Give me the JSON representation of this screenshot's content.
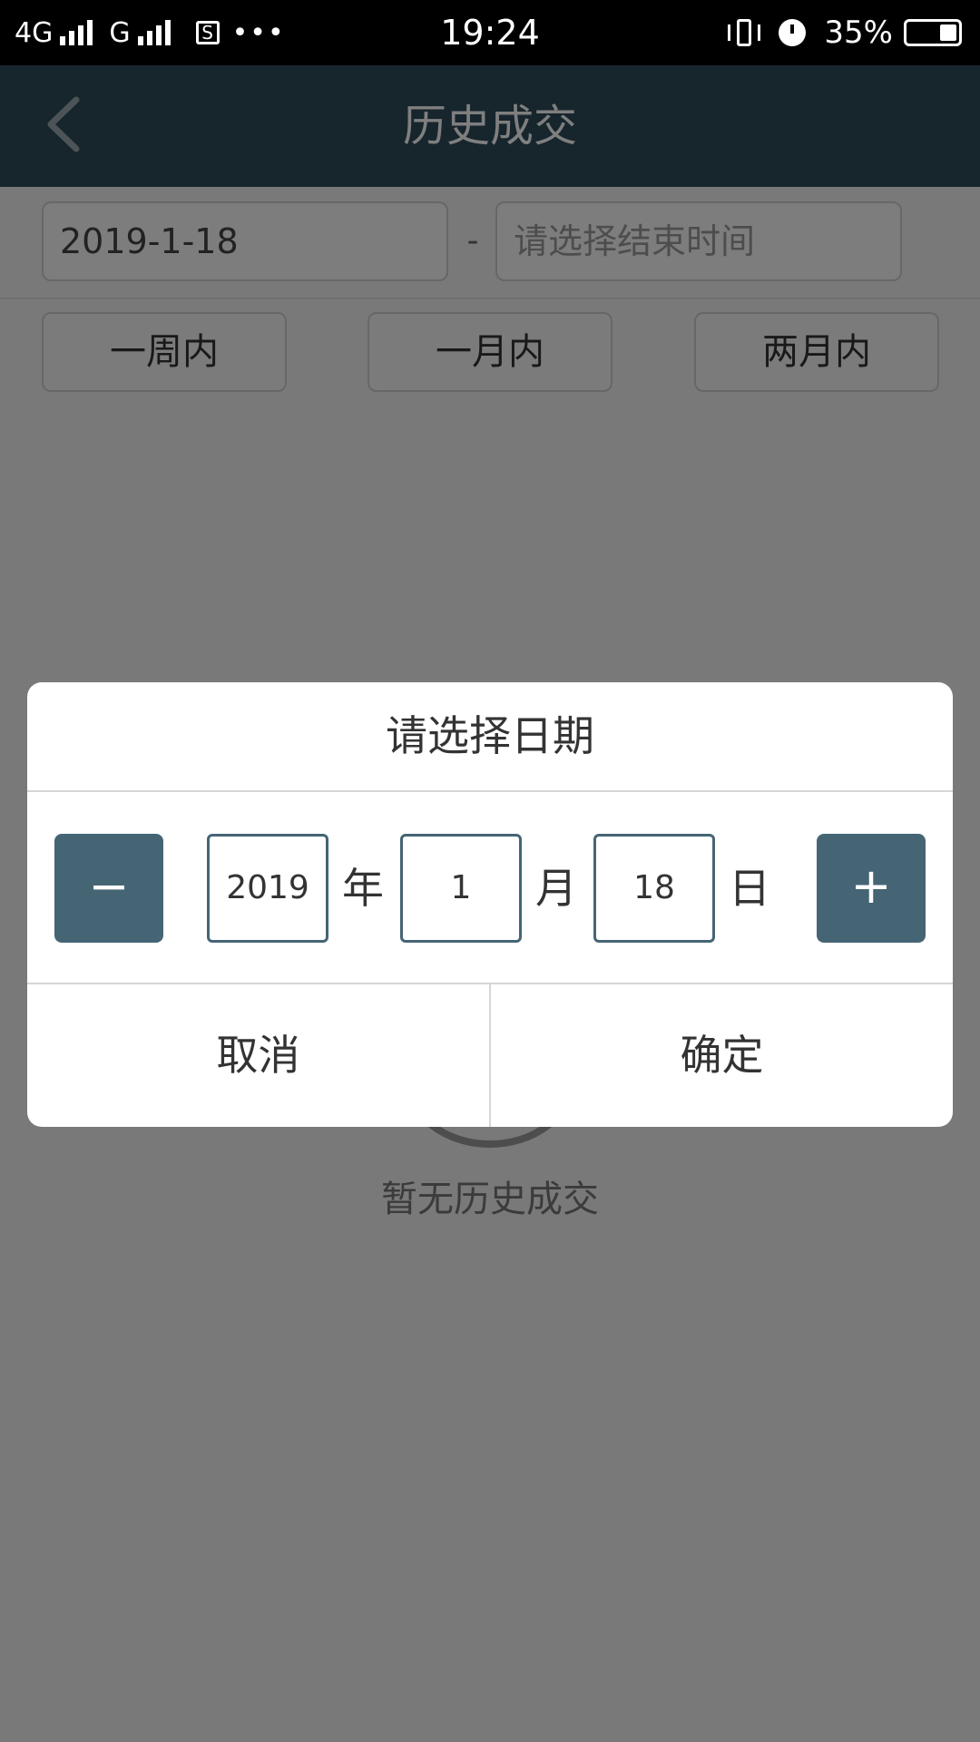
{
  "status_bar": {
    "network1": "4G",
    "network2": "G",
    "dots": "•••",
    "time": "19:24",
    "battery": "35%"
  },
  "header": {
    "title": "历史成交"
  },
  "filter": {
    "start_date": "2019-1-18",
    "separator": "-",
    "end_placeholder": "请选择结束时间",
    "ranges": [
      "一周内",
      "一月内",
      "两月内"
    ]
  },
  "content": {
    "empty_text": "暂无历史成交"
  },
  "dialog": {
    "title": "请选择日期",
    "minus_label": "−",
    "plus_label": "+",
    "year": "2019",
    "month": "1",
    "day": "18",
    "year_unit": "年",
    "month_unit": "月",
    "day_unit": "日",
    "cancel": "取消",
    "confirm": "确定"
  },
  "colors": {
    "header_bg": "#2f4b5a",
    "accent": "#456574"
  }
}
